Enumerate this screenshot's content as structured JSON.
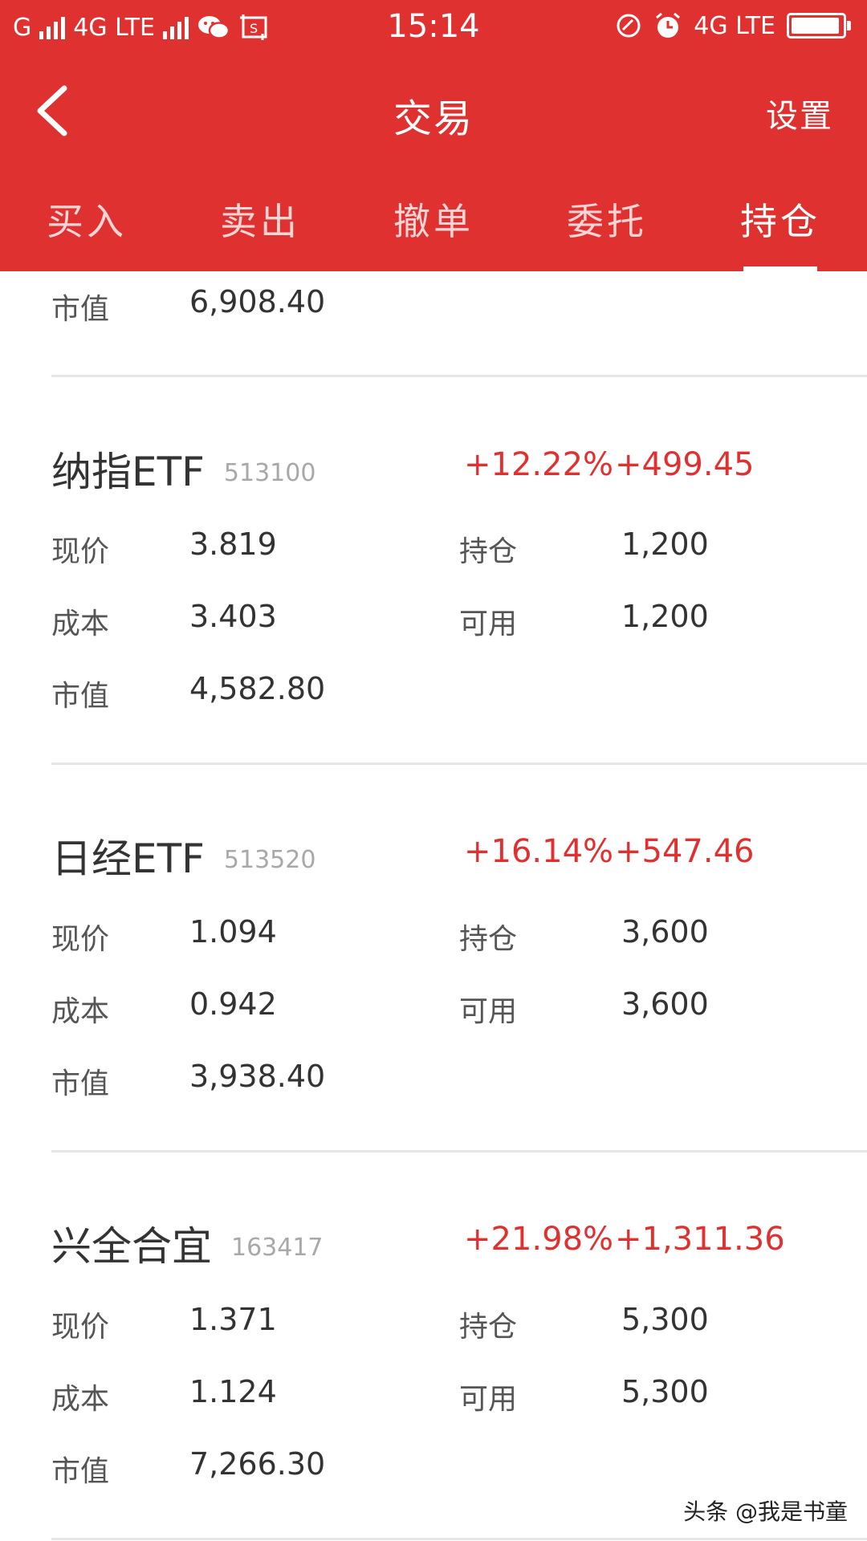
{
  "status_bar": {
    "carrier1": "G",
    "network1": "4G LTE",
    "time": "15:14",
    "network2": "4G LTE",
    "battery_level": 0.95
  },
  "header": {
    "title": "交易",
    "settings_label": "设置",
    "accent_color": "#e03131"
  },
  "tabs": [
    {
      "label": "买入",
      "active": false
    },
    {
      "label": "卖出",
      "active": false
    },
    {
      "label": "撤单",
      "active": false
    },
    {
      "label": "委托",
      "active": false
    },
    {
      "label": "持仓",
      "active": true
    }
  ],
  "partial_top": {
    "market_value_label": "市值",
    "market_value": "6,908.40"
  },
  "labels": {
    "price": "现价",
    "cost": "成本",
    "market_value": "市值",
    "position": "持仓",
    "available": "可用"
  },
  "holdings": [
    {
      "name": "纳指ETF",
      "code": "513100",
      "pct_change": "+12.22%",
      "profit": "+499.45",
      "price": "3.819",
      "cost": "3.403",
      "market_value": "4,582.80",
      "position": "1,200",
      "available": "1,200"
    },
    {
      "name": "日经ETF",
      "code": "513520",
      "pct_change": "+16.14%",
      "profit": "+547.46",
      "price": "1.094",
      "cost": "0.942",
      "market_value": "3,938.40",
      "position": "3,600",
      "available": "3,600"
    },
    {
      "name": "兴全合宜",
      "code": "163417",
      "pct_change": "+21.98%",
      "profit": "+1,311.36",
      "price": "1.371",
      "cost": "1.124",
      "market_value": "7,266.30",
      "position": "5,300",
      "available": "5,300"
    }
  ],
  "watermark": "头条 @我是书童"
}
